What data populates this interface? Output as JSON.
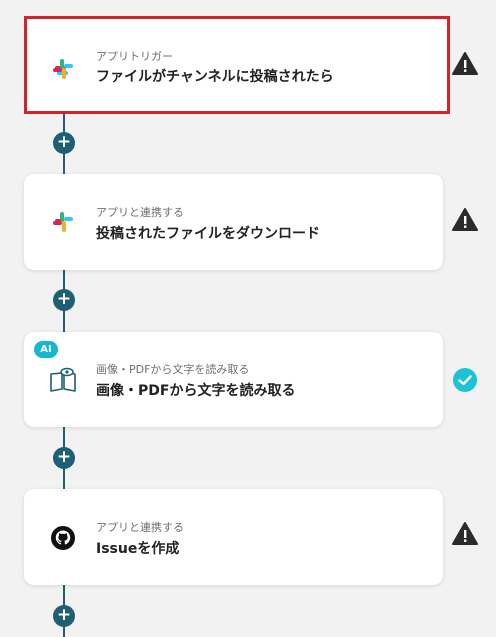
{
  "steps": [
    {
      "subtitle": "アプリトリガー",
      "title": "ファイルがチャンネルに投稿されたら",
      "icon": "slack-icon",
      "status": "warning",
      "selected": true
    },
    {
      "subtitle": "アプリと連携する",
      "title": "投稿されたファイルをダウンロード",
      "icon": "slack-icon",
      "status": "warning"
    },
    {
      "subtitle": "画像・PDFから文字を読み取る",
      "title": "画像・PDFから文字を読み取る",
      "icon": "book-eye-icon",
      "status": "done",
      "badge": "AI"
    },
    {
      "subtitle": "アプリと連携する",
      "title": "Issueを作成",
      "icon": "github-icon",
      "status": "warning"
    }
  ],
  "add_button_label": "+",
  "colors": {
    "connector": "#1f5f74",
    "selected_border": "#d3242b",
    "warning": "#2b2b2b",
    "done": "#1cc3d6",
    "ai_badge": "#17b6cf"
  }
}
